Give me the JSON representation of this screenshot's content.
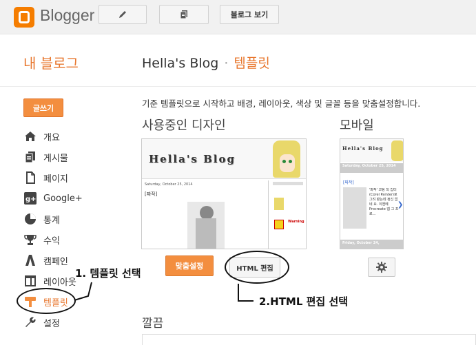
{
  "topbar": {
    "brand": "Blogger",
    "view_blog_label": "블로그 보기",
    "icons": [
      "blogger-logo-icon",
      "pencil-icon",
      "posts-icon"
    ]
  },
  "header": {
    "my_blog": "내 블로그",
    "blog_name": "Hella's Blog",
    "separator": "·",
    "section": "템플릿"
  },
  "sidebar": {
    "write_label": "글쓰기",
    "items": [
      {
        "label": "개요",
        "icon": "home-icon"
      },
      {
        "label": "게시물",
        "icon": "posts-icon"
      },
      {
        "label": "페이지",
        "icon": "pages-icon"
      },
      {
        "label": "Google+",
        "icon": "google-plus-icon"
      },
      {
        "label": "통계",
        "icon": "pie-chart-icon"
      },
      {
        "label": "수익",
        "icon": "trophy-icon"
      },
      {
        "label": "캠페인",
        "icon": "campaign-icon"
      },
      {
        "label": "레이아웃",
        "icon": "layout-icon"
      },
      {
        "label": "템플릿",
        "icon": "template-icon",
        "active": true
      },
      {
        "label": "설정",
        "icon": "wrench-icon"
      }
    ]
  },
  "main": {
    "description": "기준 템플릿으로 시작하고 배경, 레이아웃, 색상 및 글꼴 등을 맞춤설정합니다.",
    "current_design_title": "사용중인 디자인",
    "mobile_title": "모바일",
    "customize_label": "맞춤설정",
    "html_edit_label": "HTML 편집",
    "clean_title": "깔끔",
    "preview": {
      "banner_text": "Hella's Blog",
      "post_date": "Saturday, October 25, 2014",
      "post_tag": "[짜작]",
      "warning_label": "Warning",
      "mobile_date": "Saturday, October 25, 2014",
      "mobile_tag": "[짜작]",
      "mobile_snippet": "'파작' 코팅 되 립터(Corel Painter)로 그려 봤는데 정신 없네 요. 이젠에 Procreate 앱 그 프로...",
      "mobile_date2": "Friday, October 24,"
    }
  },
  "annotations": {
    "step1": "1. 템플릿 선택",
    "step2": "2.HTML 편집 선택"
  },
  "colors": {
    "accent": "#e8772e",
    "button_orange": "#f38e3f",
    "logo": "#f57d00"
  }
}
